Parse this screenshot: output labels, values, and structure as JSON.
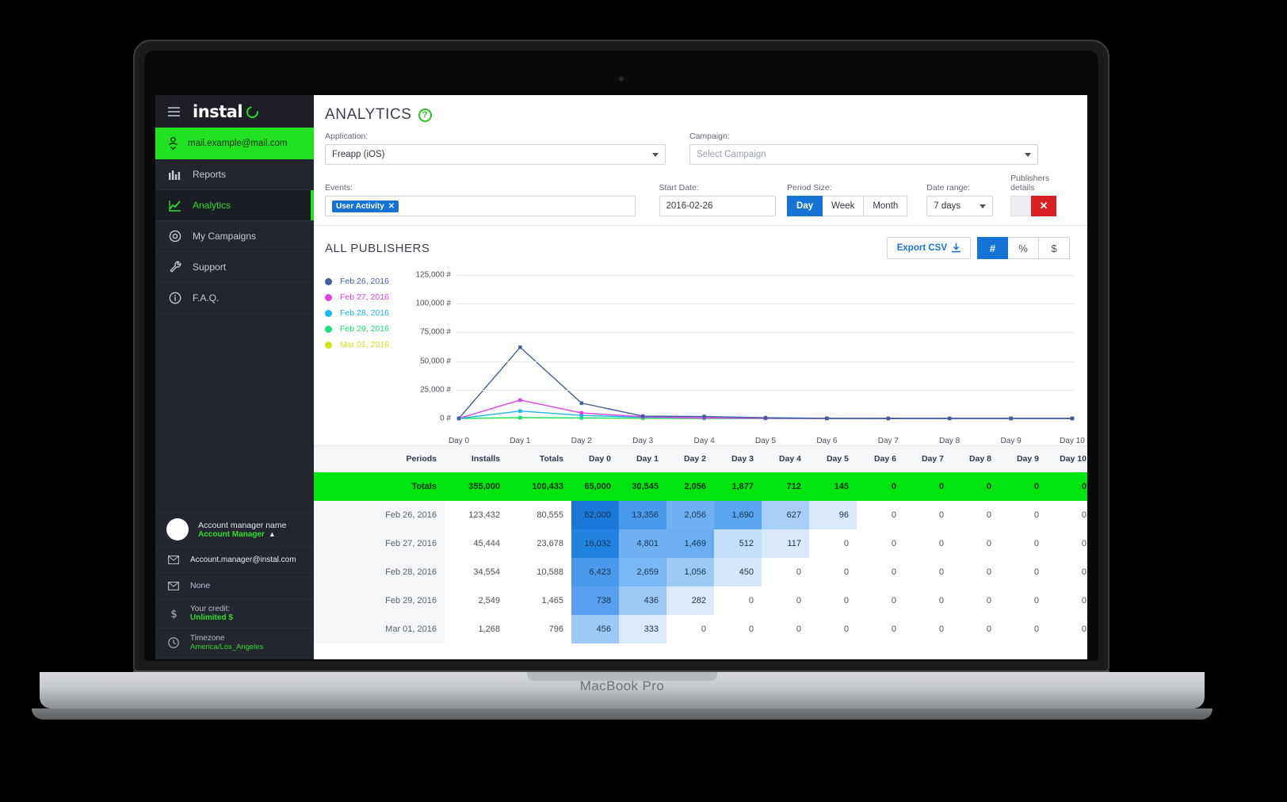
{
  "device": {
    "label": "MacBook Pro"
  },
  "sidebar": {
    "logo_text": "instal",
    "account_email": "mail.example@mail.com",
    "items": [
      {
        "label": "Reports",
        "icon": "bar-chart-icon",
        "active": false
      },
      {
        "label": "Analytics",
        "icon": "line-chart-icon",
        "active": true
      },
      {
        "label": "My Campaigns",
        "icon": "target-icon",
        "active": false
      },
      {
        "label": "Support",
        "icon": "wrench-icon",
        "active": false
      },
      {
        "label": "F.A.Q.",
        "icon": "info-icon",
        "active": false
      }
    ],
    "account_manager": {
      "name": "Account manager name",
      "role": "Account Manager",
      "email": "Account.manager@instal.com",
      "secondary": "None",
      "credit_label": "Your credit:",
      "credit_value": "Unlimited $",
      "timezone_label": "Timezone",
      "timezone_value": "America/Los_Angeles"
    }
  },
  "header": {
    "title": "ANALYTICS",
    "help": "?"
  },
  "filters": {
    "application_label": "Application:",
    "application_value": "Freapp (iOS)",
    "campaign_label": "Campaign:",
    "campaign_placeholder": "Select Campaign",
    "events_label": "Events:",
    "events_tags": [
      "User Activity"
    ],
    "start_date_label": "Start Date:",
    "start_date_value": "2016-02-26",
    "period_size_label": "Period Size:",
    "period_sizes": [
      "Day",
      "Week",
      "Month"
    ],
    "period_size_selected": "Day",
    "date_range_label": "Date range:",
    "date_range_value": "7 days",
    "publishers_details_label": "Publishers details"
  },
  "section": {
    "title": "ALL PUBLISHERS",
    "export_label": "Export CSV",
    "units": [
      "#",
      "%",
      "$"
    ],
    "unit_selected": "#"
  },
  "colors": {
    "brand_green": "#22e022",
    "totals_green": "#00e510",
    "accent_blue": "#1673d6",
    "danger_red": "#d81f21"
  },
  "chart_data": {
    "type": "line",
    "title": "",
    "xlabel": "",
    "ylabel": "",
    "ylim": [
      0,
      125000
    ],
    "yticks": [
      0,
      25000,
      50000,
      75000,
      100000,
      125000
    ],
    "ytick_labels": [
      "0 #",
      "25,000 #",
      "50,000 #",
      "75,000 #",
      "100,000 #",
      "125,000 #"
    ],
    "grid": true,
    "legend_position": "left",
    "x": [
      "Day 0",
      "Day 1",
      "Day 2",
      "Day 3",
      "Day 4",
      "Day 5",
      "Day 6",
      "Day 7",
      "Day 8",
      "Day 9",
      "Day 10"
    ],
    "series": [
      {
        "name": "Feb 26, 2016",
        "color": "#3f5f9e",
        "values": [
          0,
          62000,
          13356,
          2056,
          1690,
          627,
          96,
          0,
          0,
          0,
          0
        ]
      },
      {
        "name": "Feb 27, 2016",
        "color": "#e040e8",
        "values": [
          0,
          16032,
          4801,
          1469,
          512,
          117,
          0,
          0,
          0,
          0,
          0
        ]
      },
      {
        "name": "Feb 28, 2016",
        "color": "#1ab6f0",
        "values": [
          0,
          6423,
          2659,
          1056,
          450,
          0,
          0,
          0,
          0,
          0,
          0
        ]
      },
      {
        "name": "Feb 29, 2016",
        "color": "#18e07a",
        "values": [
          0,
          738,
          436,
          282,
          0,
          0,
          0,
          0,
          0,
          0,
          0
        ]
      },
      {
        "name": "Mar 01, 2016",
        "color": "#d4e21a",
        "values": [
          0,
          456,
          333,
          0,
          0,
          0,
          0,
          0,
          0,
          0,
          0
        ]
      }
    ]
  },
  "table": {
    "columns": [
      "Periods",
      "Installs",
      "Totals",
      "Day 0",
      "Day 1",
      "Day 2",
      "Day 3",
      "Day 4",
      "Day 5",
      "Day 6",
      "Day 7",
      "Day 8",
      "Day 9",
      "Day 10"
    ],
    "totals_row": [
      "Totals",
      "355,000",
      "100,433",
      "65,000",
      "30,545",
      "2,056",
      "1,877",
      "712",
      "145",
      "0",
      "0",
      "0",
      "0",
      "0"
    ],
    "rows": [
      {
        "cells": [
          "Feb 26, 2016",
          "123,432",
          "80,555",
          "62,000",
          "13,356",
          "2,056",
          "1,690",
          "627",
          "96",
          "0",
          "0",
          "0",
          "0",
          "0"
        ],
        "heat": [
          null,
          null,
          null,
          "#1b78d8",
          "#4a9aec",
          "#6fb0f2",
          "#5aa5ef",
          "#a8cff7",
          "#d9e9fc",
          null,
          null,
          null,
          null,
          null
        ]
      },
      {
        "cells": [
          "Feb 27, 2016",
          "45,444",
          "23,678",
          "16,032",
          "4,801",
          "1,469",
          "512",
          "117",
          "0",
          "0",
          "0",
          "0",
          "0",
          "0"
        ],
        "heat": [
          null,
          null,
          null,
          "#2282e0",
          "#6fb0f2",
          "#6aaef1",
          "#c5dffb",
          "#d9e9fc",
          null,
          null,
          null,
          null,
          null,
          null
        ]
      },
      {
        "cells": [
          "Feb 28, 2016",
          "34,554",
          "10,588",
          "6,423",
          "2,659",
          "1,056",
          "450",
          "0",
          "0",
          "0",
          "0",
          "0",
          "0",
          "0"
        ],
        "heat": [
          null,
          null,
          null,
          "#4a9aec",
          "#7bb7f4",
          "#9dc9f6",
          "#d5e7fc",
          null,
          null,
          null,
          null,
          null,
          null,
          null
        ]
      },
      {
        "cells": [
          "Feb 29, 2016",
          "2,549",
          "1,465",
          "738",
          "436",
          "282",
          "0",
          "0",
          "0",
          "0",
          "0",
          "0",
          "0",
          "0"
        ],
        "heat": [
          null,
          null,
          null,
          "#589fee",
          "#9dc9f6",
          "#dbeafd",
          null,
          null,
          null,
          null,
          null,
          null,
          null,
          null
        ]
      },
      {
        "cells": [
          "Mar 01, 2016",
          "1,268",
          "796",
          "456",
          "333",
          "0",
          "0",
          "0",
          "0",
          "0",
          "0",
          "0",
          "0",
          "0"
        ],
        "heat": [
          null,
          null,
          null,
          "#9dc9f6",
          "#dbeafd",
          null,
          null,
          null,
          null,
          null,
          null,
          null,
          null,
          null
        ]
      }
    ]
  }
}
